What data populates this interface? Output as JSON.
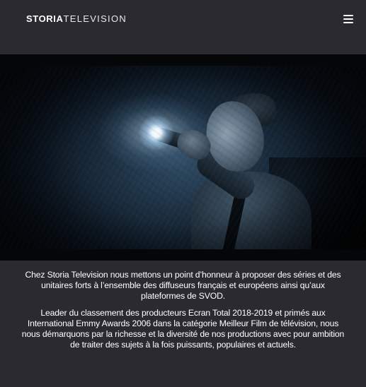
{
  "header": {
    "logo": {
      "bold_text": "STORIA",
      "light_text": "TELEVISION"
    },
    "menu_icon": "hamburger-menu-icon"
  },
  "video": {
    "description_icon": "video-still"
  },
  "content": {
    "paragraph_1": "Chez Storia Television nous mettons un point d’honneur à proposer des séries et des unitaires forts à l’ensemble des diffuseurs français et européens ainsi qu’aux plateformes de SVOD.",
    "paragraph_2": "Leader du classement des producteurs Ecran Total 2018-2019 et primés aux International Emmy Awards 2006 dans la catégorie Meilleur Film de télévision, nous nous démarquons par la richesse et la diversité de nos productions avec pour ambition de traiter des sujets à la fois puissants, populaires et actuels."
  },
  "colors": {
    "background": "#2b2a30",
    "text": "#ffffff",
    "video_letterbox": "#050608"
  }
}
